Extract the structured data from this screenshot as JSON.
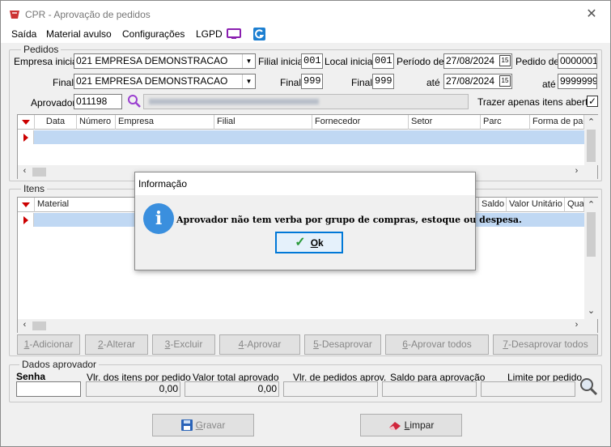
{
  "window": {
    "title": "CPR - Aprovação de pedidos",
    "close": "✕"
  },
  "menu": {
    "items": [
      "Saída",
      "Material avulso",
      "Configurações",
      "LGPD"
    ]
  },
  "pedidos": {
    "group_label": "Pedidos",
    "empresa_inicial_label": "Empresa inicial",
    "empresa_inicial_value": "021 EMPRESA DEMONSTRACAO",
    "empresa_final_label": "Final",
    "empresa_final_value": "021 EMPRESA DEMONSTRACAO",
    "filial_inicial_label": "Filial inicial",
    "filial_inicial_value": "001",
    "filial_final_label": "Final",
    "filial_final_value": "999",
    "local_inicial_label": "Local inicial",
    "local_inicial_value": "001",
    "local_final_label": "Final",
    "local_final_value": "999",
    "periodo_label": "Período de",
    "periodo_de_value": "27/08/2024",
    "periodo_ate_label": "até",
    "periodo_ate_value": "27/08/2024",
    "pedido_de_label": "Pedido de",
    "pedido_de_value": "0000001",
    "pedido_ate_label": "até",
    "pedido_ate_value": "9999999",
    "aprovador_label": "Aprovador",
    "aprovador_value": "011198",
    "trazer_label": "Trazer apenas itens abertos",
    "trazer_checked": "✓",
    "calendar_glyph": "15"
  },
  "pedidos_grid": {
    "columns": [
      "Data",
      "Número",
      "Empresa",
      "Filial",
      "Fornecedor",
      "Setor",
      "Parc",
      "Forma de paga"
    ]
  },
  "itens": {
    "group_label": "Itens",
    "columns": [
      "Material",
      "Saldo",
      "Valor Unitário",
      "Quan"
    ]
  },
  "actions": {
    "adicionar": {
      "key": "1",
      "label": "-Adicionar"
    },
    "alterar": {
      "key": "2",
      "label": "-Alterar"
    },
    "excluir": {
      "key": "3",
      "label": "-Excluir"
    },
    "aprovar": {
      "key": "4",
      "label": "-Aprovar"
    },
    "desaprovar": {
      "key": "5",
      "label": "-Desaprovar"
    },
    "aprovar_todos": {
      "key": "6",
      "label": "-Aprovar todos"
    },
    "desaprovar_todos": {
      "key": "7",
      "label": "-Desaprovar todos"
    }
  },
  "dados": {
    "group_label": "Dados aprovador",
    "senha_label": "Senha",
    "vlr_itens_label": "Vlr. dos itens por pedido",
    "vlr_itens_value": "0,00",
    "valor_total_label": "Valor total aprovado",
    "valor_total_value": "0,00",
    "vlr_pedidos_label": "Vlr. de pedidos aprov.",
    "saldo_label": "Saldo para aprovação",
    "limite_label": "Limite por pedido"
  },
  "footer": {
    "gravar_key": "G",
    "gravar_rest": "ravar",
    "limpar_key": "L",
    "limpar_rest": "impar"
  },
  "dialog": {
    "title": "Informação",
    "icon": "i",
    "message": "Aprovador não tem verba por grupo de compras, estoque ou despesa.",
    "ok_key": "O",
    "ok_rest": "k",
    "ok_check": "✓"
  },
  "colors": {
    "accent": "#0078d7",
    "selection": "#c0d8f3",
    "marker": "#cc0000",
    "info": "#3a8fde"
  }
}
